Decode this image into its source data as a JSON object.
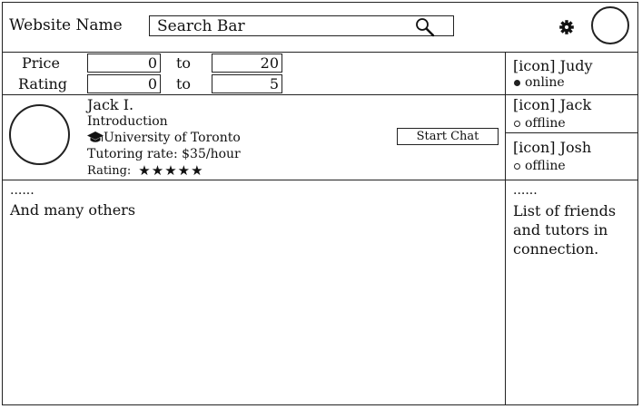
{
  "header": {
    "site_name": "Website Name",
    "search_placeholder": "Search Bar"
  },
  "filters": {
    "price": {
      "label": "Price",
      "min": "0",
      "to": "to",
      "max": "20"
    },
    "rating": {
      "label": "Rating",
      "min": "0",
      "to": "to",
      "max": "5"
    }
  },
  "tutor": {
    "name": "Jack I.",
    "intro": "Introduction",
    "university": "University of Toronto",
    "rate": "Tutoring rate: $35/hour",
    "rating_label": "Rating:",
    "stars": "★★★★★",
    "rating_value": 5,
    "chat_button": "Start Chat"
  },
  "results": {
    "ellipsis": "......",
    "more_text": "And many others"
  },
  "friends": [
    {
      "name": "[icon] Judy",
      "status": "online"
    },
    {
      "name": "[icon] Jack",
      "status": "offline"
    },
    {
      "name": "[icon] Josh",
      "status": "offline"
    }
  ],
  "sidebar_note": {
    "ellipsis": "......",
    "text": "List of friends and tutors in connection."
  },
  "icons": {
    "search": "search-icon",
    "settings": "gear-icon",
    "education": "graduation-cap-icon"
  }
}
